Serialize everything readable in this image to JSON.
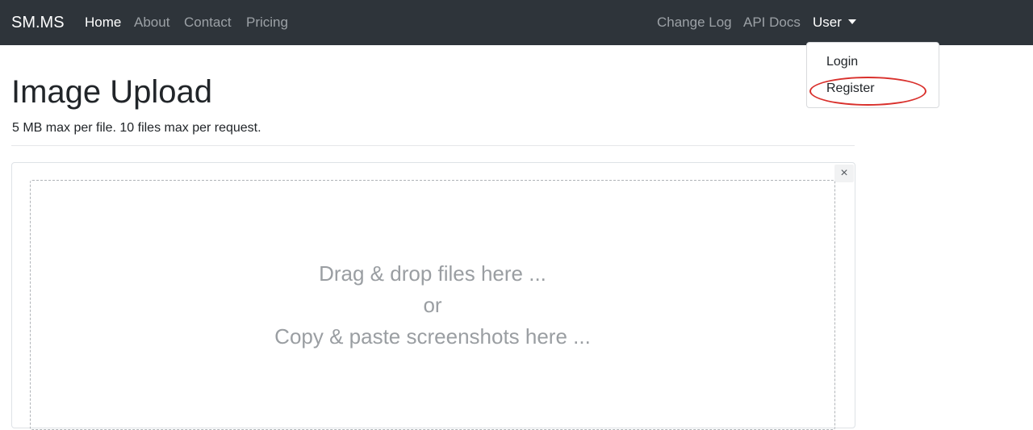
{
  "navbar": {
    "brand": "SM.MS",
    "links": [
      {
        "label": "Home",
        "active": true
      },
      {
        "label": "About"
      },
      {
        "label": "Contact"
      },
      {
        "label": "Pricing"
      }
    ],
    "right_links": [
      {
        "label": "Change Log"
      },
      {
        "label": "API Docs"
      }
    ],
    "user_label": "User"
  },
  "dropdown": {
    "items": [
      {
        "label": "Login"
      },
      {
        "label": "Register"
      }
    ],
    "highlight_color": "#d9302c"
  },
  "main": {
    "title": "Image Upload",
    "subtitle": "5 MB max per file. 10 files max per request.",
    "close_symbol": "×",
    "drop_zone": {
      "line1": "Drag & drop files here ...",
      "line2": "or",
      "line3": "Copy & paste screenshots here ..."
    }
  },
  "colors": {
    "navbar_bg": "#2e343a",
    "nav_inactive": "#9ca1a6",
    "placeholder_text": "#9a9ea2"
  }
}
